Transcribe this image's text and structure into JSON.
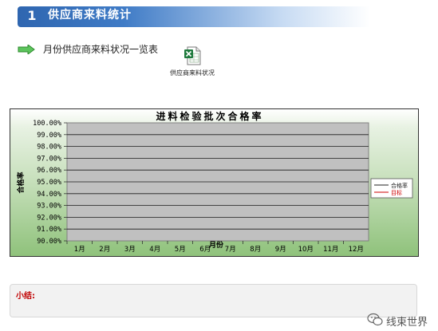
{
  "section": {
    "number": "1",
    "title": "供应商来料统计"
  },
  "link": {
    "label": "月份供应商来料状况一览表"
  },
  "file": {
    "label": "供应商来料状况",
    "icon": "excel-file-icon"
  },
  "chart_data": {
    "type": "line",
    "title": "进料检验批次合格率",
    "xlabel": "月份",
    "ylabel": "合格率",
    "categories": [
      "1月",
      "2月",
      "3月",
      "4月",
      "5月",
      "6月",
      "7月",
      "8月",
      "9月",
      "10月",
      "11月",
      "12月"
    ],
    "y_ticks": [
      "90.00%",
      "91.00%",
      "92.00%",
      "93.00%",
      "94.00%",
      "95.00%",
      "96.00%",
      "97.00%",
      "98.00%",
      "99.00%",
      "100.00%"
    ],
    "ylim": [
      0.9,
      1.0
    ],
    "grid": true,
    "legend": "right",
    "series": [
      {
        "name": "合格率",
        "color": "#222222",
        "values": []
      },
      {
        "name": "目标",
        "color": "#cc0000",
        "values": []
      }
    ]
  },
  "summary": {
    "label": "小结:"
  },
  "watermark": {
    "text": "线束世界"
  },
  "colors": {
    "header": "#2f66b0",
    "arrow": "#5cc45c",
    "summary_label": "#c00000"
  }
}
